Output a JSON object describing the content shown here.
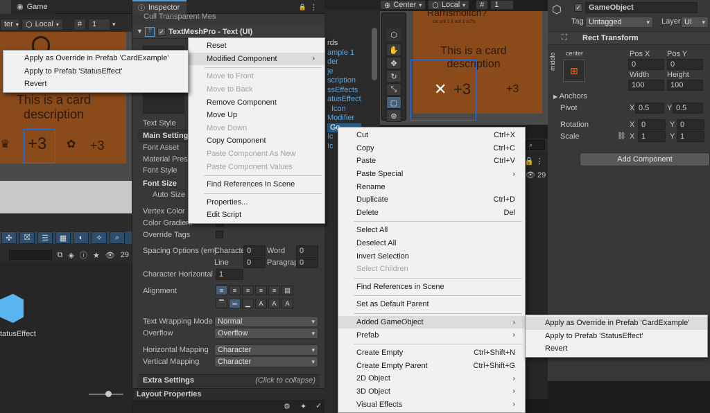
{
  "game_tab": "Game",
  "inspector_tab": "Inspector",
  "scene_toolbar": {
    "center": "Center",
    "local": "Local",
    "grid_count": "1"
  },
  "left_toolbar": {
    "pivot": "ter",
    "space": "Local",
    "grid_count": "1"
  },
  "card": {
    "description": "This is a card description",
    "value": "+3",
    "title_fragment": "Rarrismoltcn?",
    "subtitle_fragment": "ca unl 1 il unl 1 is?s"
  },
  "inspector": {
    "cull_header": "Cull Transparent Mes",
    "component_title": "TextMeshPro - Text (UI)",
    "rows": {
      "text_style": "Text Style",
      "main_settings": "Main Settings",
      "font_asset": "Font Asset",
      "material_preset": "Material Prese",
      "font_style": "Font Style",
      "font_size": "Font Size",
      "auto_size": "Auto Size",
      "vertex_color": "Vertex Color",
      "color_gradient": "Color Gradient",
      "override_tags": "Override Tags",
      "spacing_options": "Spacing Options (em)",
      "character": "Characte",
      "word": "Word",
      "line": "Line",
      "paragraph": "Paragrap",
      "char_h": "Character Horizontal",
      "alignment": "Alignment",
      "text_wrapping": "Text Wrapping Mode",
      "overflow": "Overflow",
      "h_mapping": "Horizontal Mapping",
      "v_mapping": "Vertical Mapping",
      "extra_settings": "Extra Settings",
      "click_collapse": "(Click to collapse)",
      "layout_properties": "Layout Properties"
    },
    "values": {
      "character": "0",
      "word": "0",
      "line": "0",
      "paragraph": "0",
      "char_h": "1",
      "wrapping": "Normal",
      "overflow": "Overflow",
      "h_mapping": "Character",
      "v_mapping": "Character"
    }
  },
  "hierarchy_items": [
    "rds",
    "ample 1",
    "der",
    "je",
    "scription",
    "ssEffects",
    "atusEffect",
    "Icon",
    "Modifier",
    "Go",
    "Ic",
    "Ic"
  ],
  "project": {
    "asset_label": "tatusEffect",
    "count": "29"
  },
  "right_count": "29",
  "right_inspector": {
    "object_name": "GameObject",
    "tag_label": "Tag",
    "tag_value": "Untagged",
    "layer_label": "Layer",
    "layer_value": "UI",
    "rect_transform": "Rect Transform",
    "anchor_h": "center",
    "anchor_v": "middle",
    "pos_x_label": "Pos X",
    "pos_y_label": "Pos Y",
    "pos_x": "0",
    "pos_y": "0",
    "width_label": "Width",
    "height_label": "Height",
    "width": "100",
    "height": "100",
    "anchors": "Anchors",
    "pivot": "Pivot",
    "pivot_x": "0.5",
    "pivot_y": "0.5",
    "rotation": "Rotation",
    "rot_x": "0",
    "rot_y": "0",
    "scale": "Scale",
    "scale_x": "1",
    "scale_y": "1",
    "x": "X",
    "y": "Y",
    "add_component": "Add Component"
  },
  "menu_component": {
    "items": [
      "Reset",
      "Modified Component",
      "Move to Front",
      "Move to Back",
      "Remove Component",
      "Move Up",
      "Move Down",
      "Copy Component",
      "Paste Component As New",
      "Paste Component Values",
      "Find References In Scene",
      "Properties...",
      "Edit Script"
    ]
  },
  "menu_modified_sub": {
    "items": [
      "Apply as Override in Prefab 'CardExample'",
      "Apply to Prefab 'StatusEffect'",
      "Revert"
    ]
  },
  "menu_hierarchy": {
    "items": [
      "Cut",
      "Copy",
      "Paste",
      "Paste Special",
      "Rename",
      "Duplicate",
      "Delete",
      "Select All",
      "Deselect All",
      "Invert Selection",
      "Select Children",
      "Find References in Scene",
      "Set as Default Parent",
      "Added GameObject",
      "Prefab",
      "Create Empty",
      "Create Empty Parent",
      "2D Object",
      "3D Object",
      "Visual Effects"
    ],
    "shortcuts": {
      "cut": "Ctrl+X",
      "copy": "Ctrl+C",
      "paste": "Ctrl+V",
      "duplicate": "Ctrl+D",
      "delete": "Del",
      "create_empty": "Ctrl+Shift+N",
      "create_empty_parent": "Ctrl+Shift+G"
    }
  },
  "menu_added_sub": {
    "items": [
      "Apply as Override in Prefab 'CardExample'",
      "Apply to Prefab 'StatusEffect'",
      "Revert"
    ]
  }
}
